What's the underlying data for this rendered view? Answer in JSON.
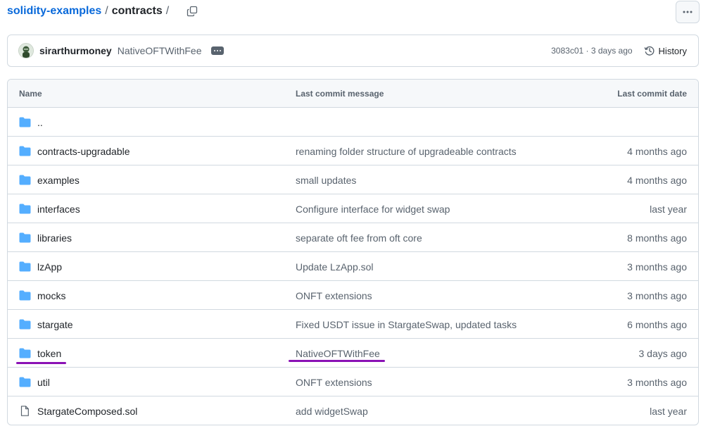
{
  "breadcrumb": {
    "repo": "solidity-examples",
    "separator": "/",
    "dir": "contracts",
    "trailing": "/"
  },
  "commit": {
    "author": "sirarthurmoney",
    "message": "NativeOFTWithFee",
    "meta": "3083c01 · 3 days ago",
    "history_label": "History"
  },
  "table": {
    "headers": {
      "name": "Name",
      "message": "Last commit message",
      "date": "Last commit date"
    },
    "rows": [
      {
        "type": "folder",
        "name": "..",
        "message": "",
        "date": ""
      },
      {
        "type": "folder",
        "name": "contracts-upgradable",
        "message": "renaming folder structure of upgradeable contracts",
        "date": "4 months ago"
      },
      {
        "type": "folder",
        "name": "examples",
        "message": "small updates",
        "date": "4 months ago"
      },
      {
        "type": "folder",
        "name": "interfaces",
        "message": "Configure interface for widget swap",
        "date": "last year"
      },
      {
        "type": "folder",
        "name": "libraries",
        "message": "separate oft fee from oft core",
        "date": "8 months ago"
      },
      {
        "type": "folder",
        "name": "lzApp",
        "message": "Update LzApp.sol",
        "date": "3 months ago"
      },
      {
        "type": "folder",
        "name": "mocks",
        "message": "ONFT extensions",
        "date": "3 months ago"
      },
      {
        "type": "folder",
        "name": "stargate",
        "message": "Fixed USDT issue in StargateSwap, updated tasks",
        "date": "6 months ago"
      },
      {
        "type": "folder",
        "name": "token",
        "message": "NativeOFTWithFee",
        "date": "3 days ago"
      },
      {
        "type": "folder",
        "name": "util",
        "message": "ONFT extensions",
        "date": "3 months ago"
      },
      {
        "type": "file",
        "name": "StargateComposed.sol",
        "message": "add widgetSwap",
        "date": "last year"
      }
    ]
  },
  "colors": {
    "link": "#0969da",
    "folder": "#54aeff",
    "highlight": "#8a12b5"
  }
}
